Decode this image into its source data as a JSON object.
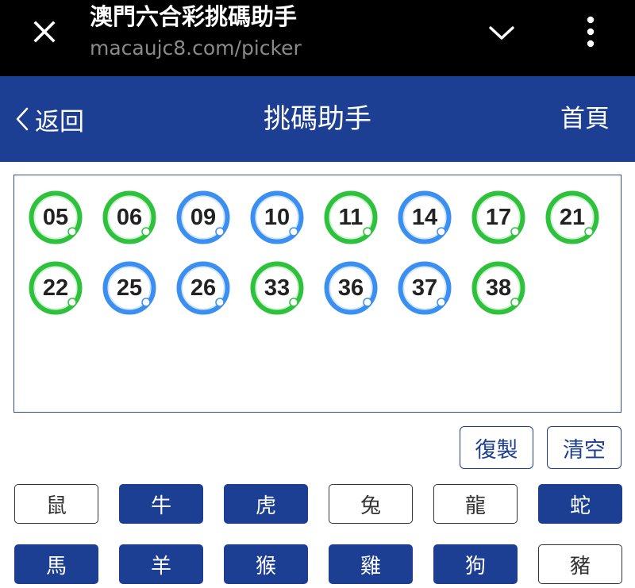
{
  "browser": {
    "title": "澳門六合彩挑碼助手",
    "url": "macaujc8.com/picker",
    "close_icon": "close-icon",
    "chevron_icon": "chevron-down-icon",
    "menu_icon": "more-vertical-icon"
  },
  "header": {
    "back_label": "返回",
    "title": "挑碼助手",
    "home_label": "首頁"
  },
  "colors": {
    "header_bg": "#1c3f94",
    "ball_green": "#2ec23c",
    "ball_blue": "#3b8ff0"
  },
  "balls": [
    {
      "number": "05",
      "color": "green"
    },
    {
      "number": "06",
      "color": "green"
    },
    {
      "number": "09",
      "color": "blue"
    },
    {
      "number": "10",
      "color": "blue"
    },
    {
      "number": "11",
      "color": "green"
    },
    {
      "number": "14",
      "color": "blue"
    },
    {
      "number": "17",
      "color": "green"
    },
    {
      "number": "21",
      "color": "green"
    },
    {
      "number": "22",
      "color": "green"
    },
    {
      "number": "25",
      "color": "blue"
    },
    {
      "number": "26",
      "color": "blue"
    },
    {
      "number": "33",
      "color": "green"
    },
    {
      "number": "36",
      "color": "blue"
    },
    {
      "number": "37",
      "color": "blue"
    },
    {
      "number": "38",
      "color": "green"
    }
  ],
  "actions": {
    "copy_label": "復製",
    "clear_label": "清空"
  },
  "zodiac": [
    {
      "label": "鼠",
      "selected": false
    },
    {
      "label": "牛",
      "selected": true
    },
    {
      "label": "虎",
      "selected": true
    },
    {
      "label": "兔",
      "selected": false
    },
    {
      "label": "龍",
      "selected": false
    },
    {
      "label": "蛇",
      "selected": true
    },
    {
      "label": "馬",
      "selected": true
    },
    {
      "label": "羊",
      "selected": true
    },
    {
      "label": "猴",
      "selected": true
    },
    {
      "label": "雞",
      "selected": true
    },
    {
      "label": "狗",
      "selected": true
    },
    {
      "label": "豬",
      "selected": false
    }
  ]
}
